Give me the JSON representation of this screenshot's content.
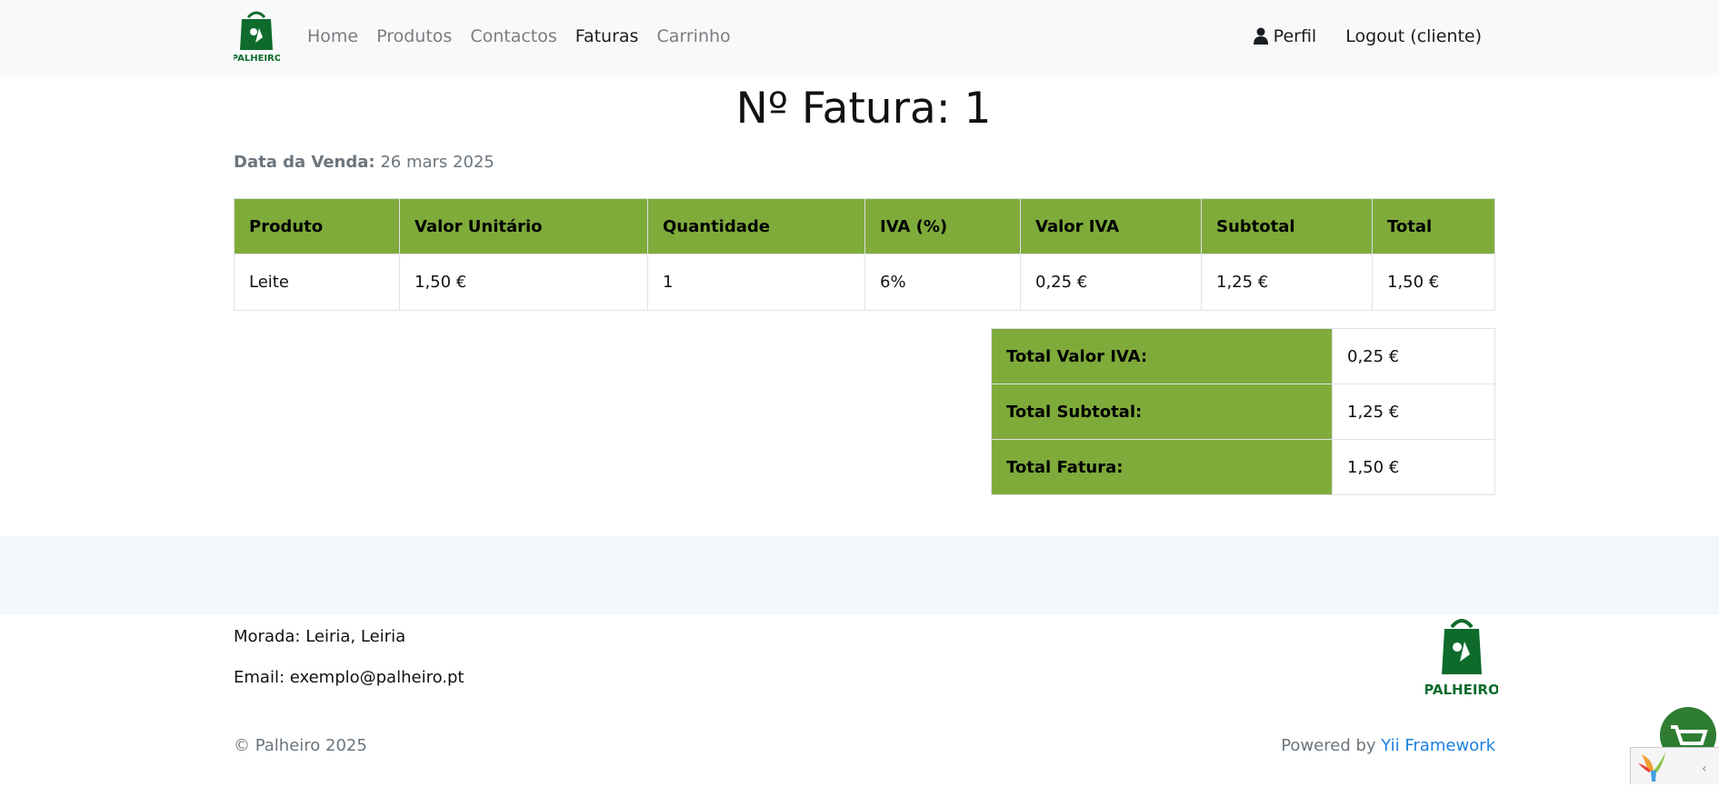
{
  "navbar": {
    "brand_text": "PALHEIRO",
    "links": [
      {
        "label": "Home",
        "active": false
      },
      {
        "label": "Produtos",
        "active": false
      },
      {
        "label": "Contactos",
        "active": false
      },
      {
        "label": "Faturas",
        "active": true
      },
      {
        "label": "Carrinho",
        "active": false
      }
    ],
    "profile_label": "Perfil",
    "logout_label": "Logout (cliente)"
  },
  "invoice": {
    "title": "Nº Fatura: 1",
    "date_label": "Data da Venda:",
    "date_value": "26 mars 2025",
    "columns": [
      "Produto",
      "Valor Unitário",
      "Quantidade",
      "IVA (%)",
      "Valor IVA",
      "Subtotal",
      "Total"
    ],
    "rows": [
      [
        "Leite",
        "1,50 €",
        "1",
        "6%",
        "0,25 €",
        "1,25 €",
        "1,50 €"
      ]
    ],
    "totals": [
      {
        "label": "Total Valor IVA:",
        "value": "0,25 €"
      },
      {
        "label": "Total Subtotal:",
        "value": "1,25 €"
      },
      {
        "label": "Total Fatura:",
        "value": "1,50 €"
      }
    ]
  },
  "footer": {
    "address": "Morada: Leiria, Leiria",
    "email": "Email: exemplo@palheiro.pt",
    "logo_text": "PALHEIRO",
    "copyright": "© Palheiro 2025",
    "powered_prefix": "Powered by ",
    "powered_link": "Yii Framework"
  },
  "colors": {
    "accent_green": "#7fab3b",
    "brand_green": "#0e6b2c",
    "link_blue": "#1a7fe0"
  },
  "icons": {
    "brand": "shopping-bag-logo-icon",
    "profile": "user-icon",
    "cart": "shopping-cart-icon",
    "debug": "yii-logo-icon",
    "toggle": "chevron-left-icon"
  }
}
